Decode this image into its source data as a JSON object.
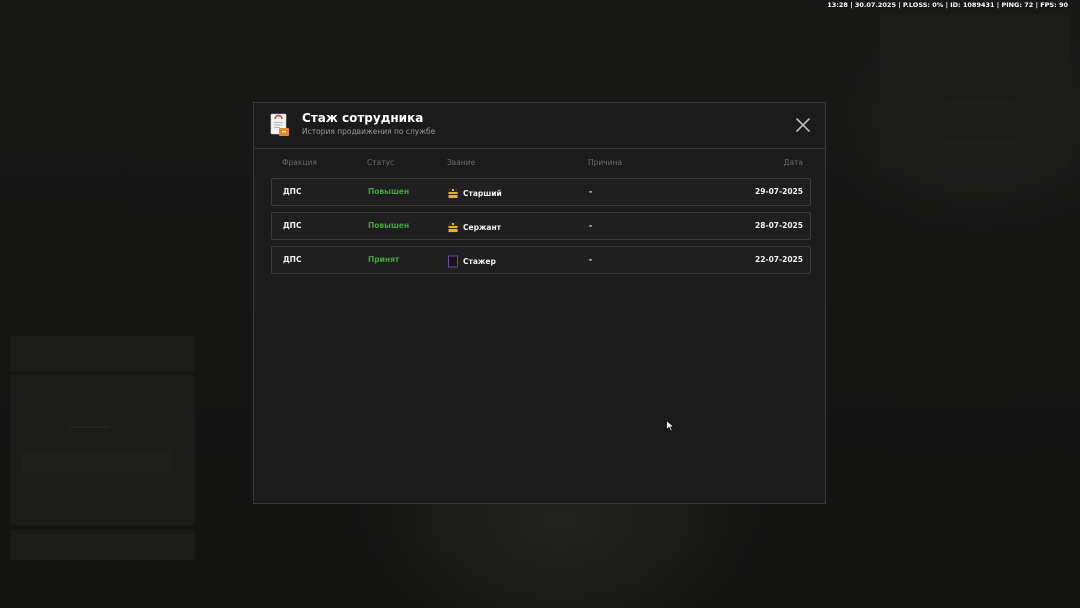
{
  "hud": {
    "status_line": "13:28 | 30.07.2025 | P.LOSS: 0% | ID: 1089431 | PING: 72 | FPS: 90"
  },
  "modal": {
    "title": "Стаж сотрудника",
    "subtitle": "История продвижения по службе",
    "icon": "document-badge-icon",
    "close_icon": "close-icon"
  },
  "table": {
    "headers": {
      "faction": "Фракция",
      "status": "Статус",
      "rank": "Звание",
      "reason": "Причина",
      "date": "Дата"
    },
    "rows": [
      {
        "faction": "ДПС",
        "status": "Повышен",
        "rank": "Старший",
        "rank_icon": "rank-stripes-icon",
        "reason": "-",
        "date": "29-07-2025"
      },
      {
        "faction": "ДПС",
        "status": "Повышен",
        "rank": "Сержант",
        "rank_icon": "rank-stripes-icon",
        "reason": "-",
        "date": "28-07-2025"
      },
      {
        "faction": "ДПС",
        "status": "Принят",
        "rank": "Стажер",
        "rank_icon": "rank-empty-icon",
        "reason": "-",
        "date": "22-07-2025"
      }
    ]
  },
  "colors": {
    "status_green": "#3fa63b",
    "rank_gold": "#e8b21f",
    "rank_purple": "#7a3fa8"
  }
}
